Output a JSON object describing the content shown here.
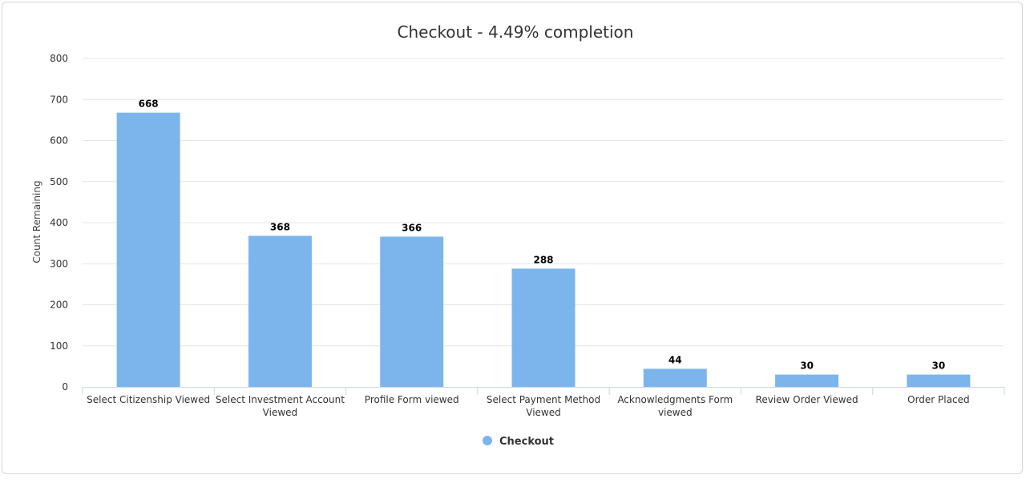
{
  "chart_data": {
    "type": "bar",
    "title": "Checkout - 4.49% completion",
    "xlabel": "",
    "ylabel": "Count Remaining",
    "ylim": [
      0,
      800
    ],
    "yticks": [
      0,
      100,
      200,
      300,
      400,
      500,
      600,
      700,
      800
    ],
    "grid": true,
    "legend_position": "bottom-center",
    "categories": [
      [
        "Select Citizenship Viewed"
      ],
      [
        "Select Investment Account",
        "Viewed"
      ],
      [
        "Profile Form viewed"
      ],
      [
        "Select Payment Method",
        "Viewed"
      ],
      [
        "Acknowledgments Form",
        "viewed"
      ],
      [
        "Review Order Viewed"
      ],
      [
        "Order Placed"
      ]
    ],
    "series": [
      {
        "name": "Checkout",
        "color": "#7cb5ec",
        "values": [
          668,
          368,
          366,
          288,
          44,
          30,
          30
        ]
      }
    ]
  }
}
